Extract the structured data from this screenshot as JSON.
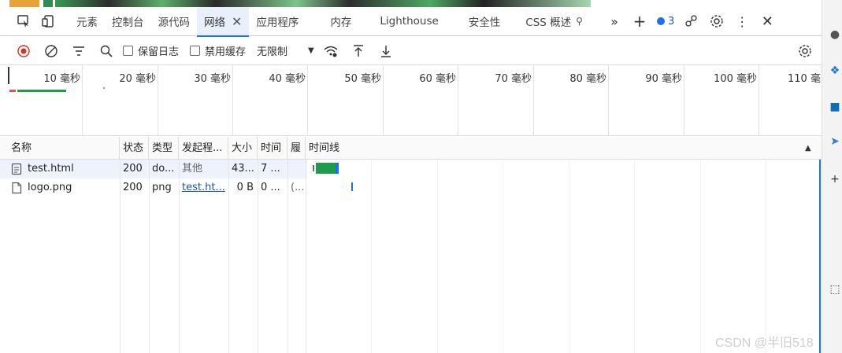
{
  "tabs": [
    {
      "label": "元素",
      "active": false
    },
    {
      "label": "控制台",
      "active": false
    },
    {
      "label": "源代码",
      "active": false
    },
    {
      "label": "网络",
      "active": true
    },
    {
      "label": "应用程序",
      "active": false
    },
    {
      "label": "内存",
      "active": false
    },
    {
      "label": "Lighthouse",
      "active": false
    },
    {
      "label": "安全性",
      "active": false
    },
    {
      "label": "CSS 概述",
      "active": false
    }
  ],
  "issues_count": "3",
  "toolbar": {
    "preserve_log_label": "保留日志",
    "disable_cache_label": "禁用缓存",
    "throttle_value": "无限制"
  },
  "overview": {
    "ticks": [
      "10 毫秒",
      "20 毫秒",
      "30 毫秒",
      "40 毫秒",
      "50 毫秒",
      "60 毫秒",
      "70 毫秒",
      "80 毫秒",
      "90 毫秒",
      "100 毫秒",
      "110 毫"
    ]
  },
  "columns": {
    "name": "名称",
    "status": "状态",
    "type": "类型",
    "initiator": "发起程...",
    "size": "大小",
    "time": "时间",
    "priority": "履",
    "waterfall": "时间线"
  },
  "requests": [
    {
      "name": "test.html",
      "status": "200",
      "type": "do...",
      "initiator": "其他",
      "size": "43...",
      "time": "7 ...",
      "priority": ""
    },
    {
      "name": "logo.png",
      "status": "200",
      "type": "png",
      "initiator": "test.ht...",
      "size": "0 B",
      "time": "0 ...",
      "priority": "(..."
    }
  ],
  "watermark": "CSDN @半旧518",
  "colors": {
    "accent": "#1a73e8",
    "bar_green": "#1e9c4a"
  }
}
